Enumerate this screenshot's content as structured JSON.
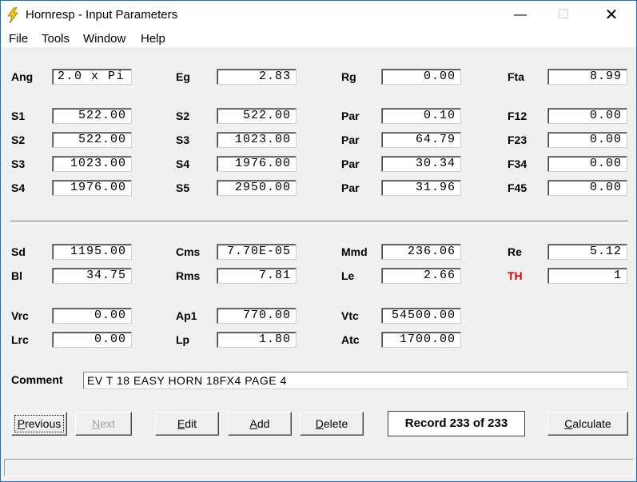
{
  "window": {
    "title": "Hornresp - Input Parameters"
  },
  "menu": [
    "File",
    "Tools",
    "Window",
    "Help"
  ],
  "rows1": [
    [
      {
        "label": "Ang",
        "value": "2.0 x Pi",
        "align": "left"
      },
      {
        "label": "Eg",
        "value": "2.83"
      },
      {
        "label": "Rg",
        "value": "0.00"
      },
      {
        "label": "Fta",
        "value": "8.99"
      }
    ]
  ],
  "rows2": [
    [
      {
        "label": "S1",
        "value": "522.00"
      },
      {
        "label": "S2",
        "value": "522.00"
      },
      {
        "label": "Par",
        "value": "0.10"
      },
      {
        "label": "F12",
        "value": "0.00"
      }
    ],
    [
      {
        "label": "S2",
        "value": "522.00"
      },
      {
        "label": "S3",
        "value": "1023.00"
      },
      {
        "label": "Par",
        "value": "64.79"
      },
      {
        "label": "F23",
        "value": "0.00"
      }
    ],
    [
      {
        "label": "S3",
        "value": "1023.00"
      },
      {
        "label": "S4",
        "value": "1976.00"
      },
      {
        "label": "Par",
        "value": "30.34"
      },
      {
        "label": "F34",
        "value": "0.00"
      }
    ],
    [
      {
        "label": "S4",
        "value": "1976.00"
      },
      {
        "label": "S5",
        "value": "2950.00"
      },
      {
        "label": "Par",
        "value": "31.96"
      },
      {
        "label": "F45",
        "value": "0.00"
      }
    ]
  ],
  "driver": [
    [
      {
        "label": "Sd",
        "value": "1195.00"
      },
      {
        "label": "Cms",
        "value": "7.70E-05"
      },
      {
        "label": "Mmd",
        "value": "236.06"
      },
      {
        "label": "Re",
        "value": "5.12"
      }
    ],
    [
      {
        "label": "Bl",
        "value": "34.75"
      },
      {
        "label": "Rms",
        "value": "7.81"
      },
      {
        "label": "Le",
        "value": "2.66"
      },
      {
        "label": "TH",
        "value": "1",
        "red": true
      }
    ]
  ],
  "chamber": [
    [
      {
        "label": "Vrc",
        "value": "0.00"
      },
      {
        "label": "Ap1",
        "value": "770.00"
      },
      {
        "label": "Vtc",
        "value": "54500.00"
      }
    ],
    [
      {
        "label": "Lrc",
        "value": "0.00"
      },
      {
        "label": "Lp",
        "value": "1.80"
      },
      {
        "label": "Atc",
        "value": "1700.00"
      }
    ]
  ],
  "comment": {
    "label": "Comment",
    "value": "EV T 18 EASY HORN 18FX4 PAGE 4"
  },
  "buttons": {
    "previous": {
      "pre": "",
      "accel": "P",
      "post": "revious"
    },
    "next": {
      "pre": "",
      "accel": "N",
      "post": "ext"
    },
    "edit": {
      "pre": "",
      "accel": "E",
      "post": "dit"
    },
    "add": {
      "pre": "",
      "accel": "A",
      "post": "dd"
    },
    "delete": {
      "pre": "",
      "accel": "D",
      "post": "elete"
    },
    "calculate": {
      "pre": "",
      "accel": "C",
      "post": "alculate"
    }
  },
  "record": "Record 233 of 233"
}
